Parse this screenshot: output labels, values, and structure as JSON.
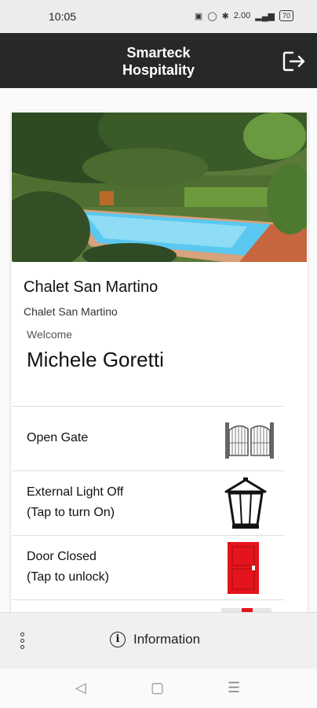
{
  "status": {
    "time": "10:05",
    "icons": [
      "nfc-icon",
      "vibrate-icon",
      "bluetooth-icon",
      "data-speed-icon",
      "signal-icon",
      "battery-icon"
    ],
    "data_speed": "2.00",
    "battery_level": "70"
  },
  "header": {
    "title_line1": "Smarteck",
    "title_line2": "Hospitality",
    "logout_icon": "logout-icon"
  },
  "property": {
    "name": "Chalet San Martino",
    "subtitle": "Chalet San Martino"
  },
  "welcome": {
    "label": "Welcome",
    "guest_name": "Michele Goretti"
  },
  "controls": [
    {
      "line1": "Open Gate",
      "line2": "",
      "icon": "gate-icon"
    },
    {
      "line1": "External Light Off",
      "line2": "(Tap to turn On)",
      "icon": "lantern-icon"
    },
    {
      "line1": "Door Closed",
      "line2": "(Tap to unlock)",
      "icon": "red-door-icon"
    }
  ],
  "bottom_bar": {
    "info_label": "Information"
  },
  "colors": {
    "header_bg": "#26282a",
    "door_red": "#e3141b",
    "pool_blue": "#5ac8f0"
  }
}
